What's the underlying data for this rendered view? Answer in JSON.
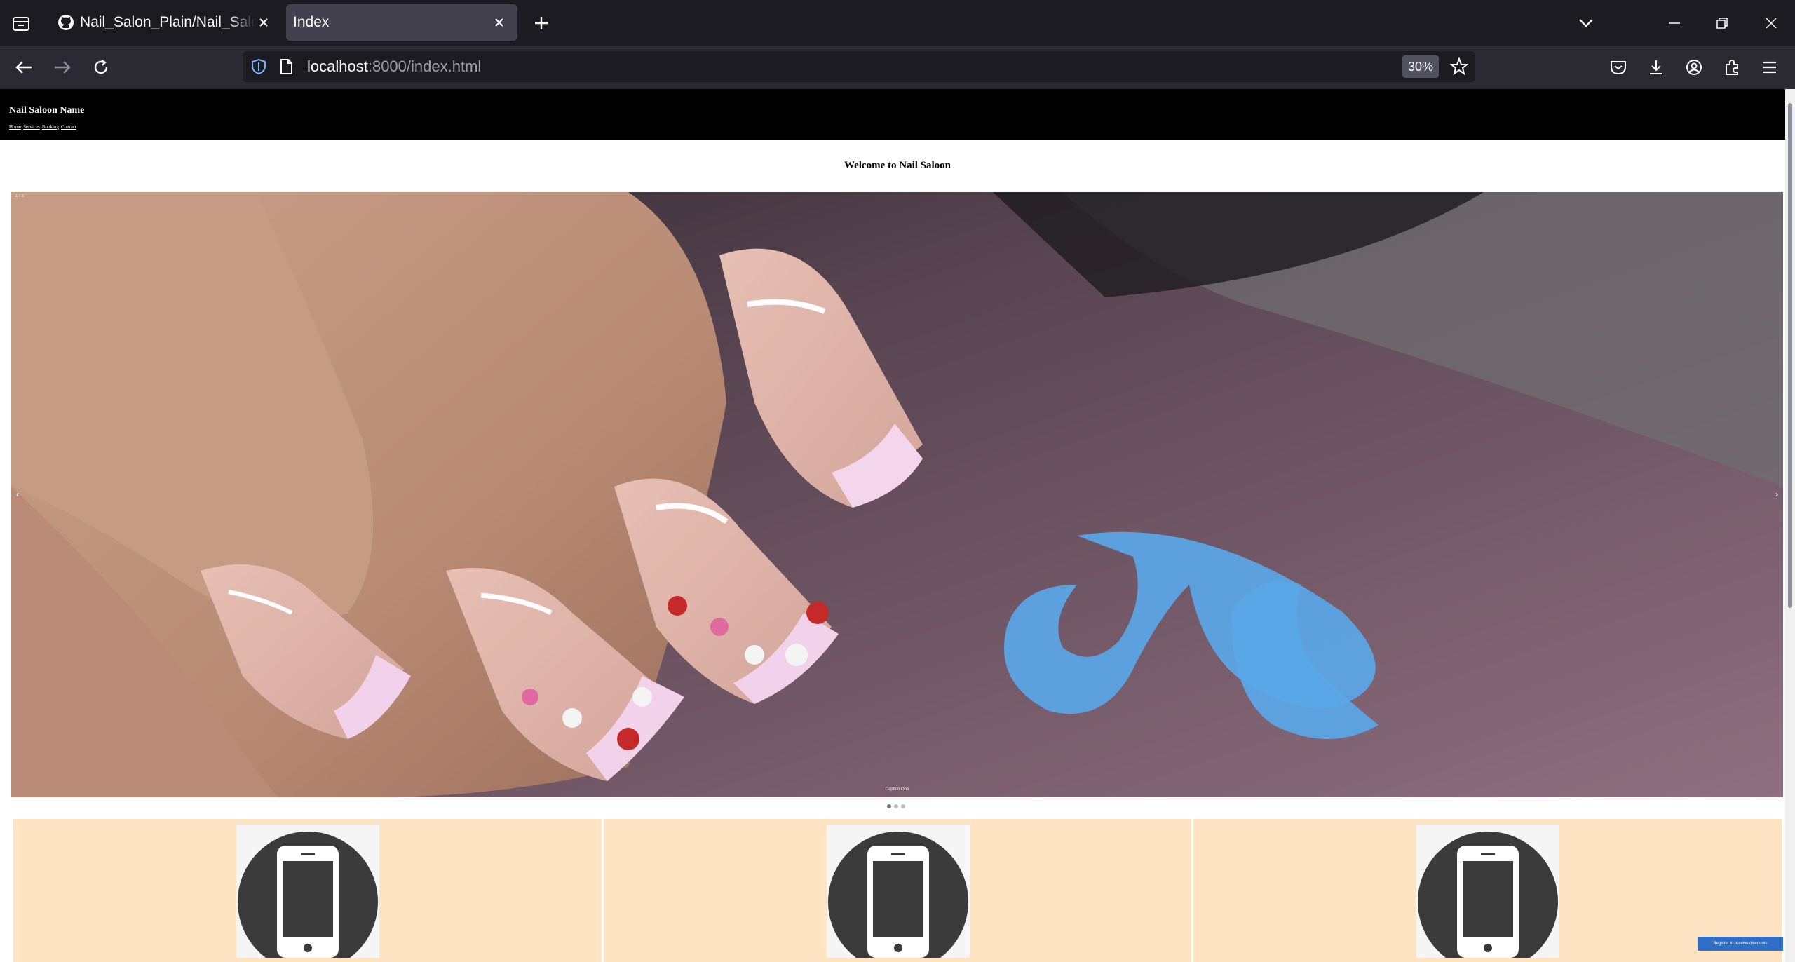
{
  "browser": {
    "tabs": [
      {
        "title": "Nail_Salon_Plain/Nail_Salon_Website",
        "icon": "github-icon",
        "active": false
      },
      {
        "title": "Index",
        "icon": "none",
        "active": true
      }
    ],
    "url_host": "localhost",
    "url_rest": ":8000/index.html",
    "zoom": "30%",
    "colors": {
      "tabbar": "#1c1b22",
      "navbar": "#2b2a33",
      "active_tab": "#42414d"
    }
  },
  "page": {
    "site_name": "Nail Saloon Name",
    "nav_links": [
      "Home",
      "Services",
      "Booking",
      "Contact"
    ],
    "welcome_heading": "Welcome to Nail Saloon",
    "carousel": {
      "counter": "1 / 3",
      "prev_label": "‹",
      "next_label": "›",
      "caption": "Caption One",
      "slide_count": 3,
      "active_index": 0
    },
    "cards": [
      {
        "icon": "smartphone-icon"
      },
      {
        "icon": "smartphone-icon"
      },
      {
        "icon": "smartphone-icon"
      }
    ],
    "float_button": "Register to receive discounts",
    "colors": {
      "header_bg": "#000000",
      "card_bg": "#ffe4c4",
      "float_button": "#2f6fc7"
    }
  }
}
